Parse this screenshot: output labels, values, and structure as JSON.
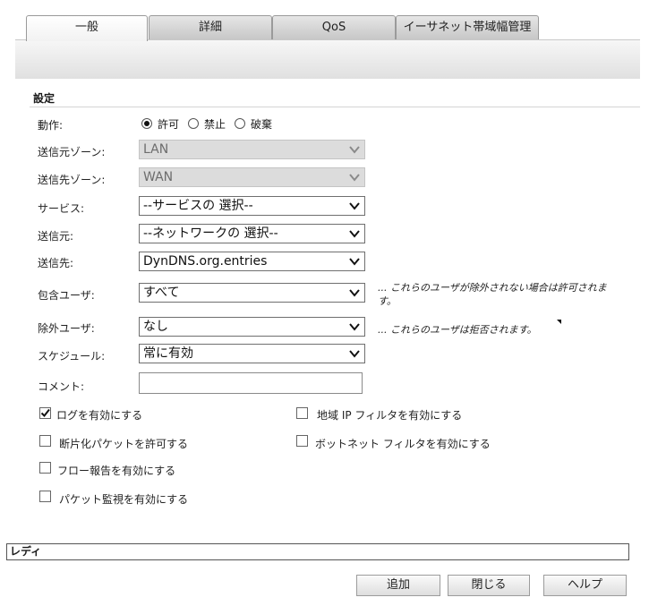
{
  "tabs": [
    "一般",
    "詳細",
    "QoS",
    "イーサネット帯域幅管理"
  ],
  "section": {
    "title": "設定"
  },
  "fields": {
    "action": {
      "label": "動作:",
      "options": [
        "許可",
        "禁止",
        "破棄"
      ],
      "selected": "許可"
    },
    "src_zone": {
      "label": "送信元ゾーン:",
      "value": "LAN"
    },
    "dst_zone": {
      "label": "送信先ゾーン:",
      "value": "WAN"
    },
    "service": {
      "label": "サービス:",
      "value": "--サービスの 選択--"
    },
    "source": {
      "label": "送信元:",
      "value": "--ネットワークの 選択--"
    },
    "destination": {
      "label": "送信先:",
      "value": "DynDNS.org.entries"
    },
    "include_users": {
      "label": "包含ユーザ:",
      "value": "すべて",
      "note_line1": "... これらのユーザが除外されない場合は許可されま",
      "note_line2": "す。"
    },
    "exclude_users": {
      "label": "除外ユーザ:",
      "value": "なし",
      "note": "... これらのユーザは拒否されます。"
    },
    "schedule": {
      "label": "スケジュール:",
      "value": "常に有効"
    },
    "comment": {
      "label": "コメント:",
      "value": ""
    }
  },
  "checkboxes": {
    "enable_logging": {
      "label": "ログを有効にする",
      "checked": true
    },
    "allow_fragments": {
      "label": "断片化パケットを許可する",
      "checked": false
    },
    "enable_flow_reporting": {
      "label": "フロー報告を有効にする",
      "checked": false
    },
    "enable_packet_monitor": {
      "label": "パケット監視を有効にする",
      "checked": false
    },
    "enable_geo_ip": {
      "label": "地域 IP フィルタを有効にする",
      "checked": false
    },
    "enable_botnet": {
      "label": "ボットネット フィルタを有効にする",
      "checked": false
    }
  },
  "status": "レディ",
  "buttons": {
    "add": "追加",
    "close": "閉じる",
    "help": "ヘルプ"
  }
}
